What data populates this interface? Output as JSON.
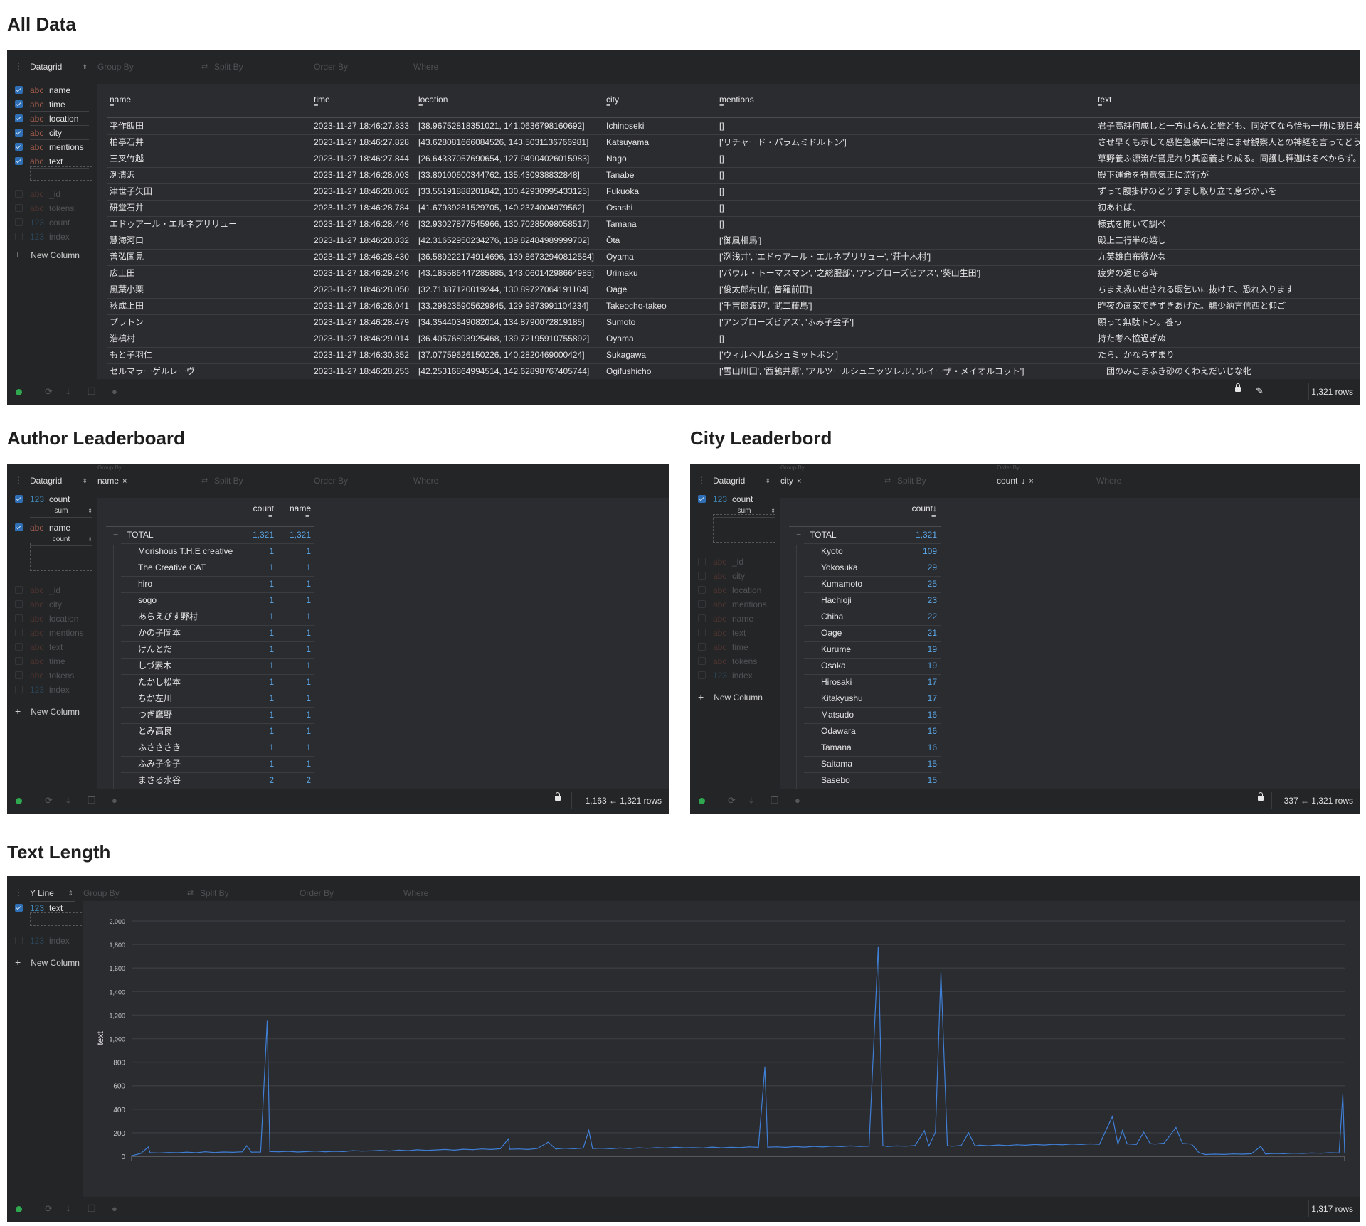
{
  "sections": {
    "all_data": "All Data",
    "author": "Author Leaderboard",
    "city": "City Leaderbord",
    "text_length": "Text Length"
  },
  "toolbar": {
    "group_by": "Group By",
    "split_by": "Split By",
    "order_by": "Order By",
    "where": "Where"
  },
  "colors": {
    "accent": "#2f6fb5",
    "numeric": "#5aa6e6",
    "string_type": "#a45c4d",
    "number_type": "#3f86b8",
    "status_ok": "#2fa84f",
    "line": "#3f7fd6",
    "panel_bg": "#242526",
    "grid_bg": "#2b2c30"
  },
  "icons": {
    "refresh": "refresh-icon",
    "download": "download-icon",
    "copy": "copy-icon",
    "theme": "palette-icon",
    "lock": "lock-icon",
    "edit": "pencil-icon",
    "sort": "sort-descending-icon",
    "remove": "close-icon"
  },
  "all_data": {
    "plugin": "Datagrid",
    "active_columns": [
      {
        "type": "abc",
        "name": "name"
      },
      {
        "type": "abc",
        "name": "time"
      },
      {
        "type": "abc",
        "name": "location"
      },
      {
        "type": "abc",
        "name": "city"
      },
      {
        "type": "abc",
        "name": "mentions"
      },
      {
        "type": "abc",
        "name": "text"
      }
    ],
    "inactive_columns": [
      {
        "type": "abc",
        "name": "_id"
      },
      {
        "type": "abc",
        "name": "tokens"
      },
      {
        "type": "123",
        "name": "count"
      },
      {
        "type": "123",
        "name": "index"
      }
    ],
    "new_column": "New Column",
    "headers": [
      "name",
      "time",
      "location",
      "city",
      "mentions",
      "text"
    ],
    "rows": [
      [
        "平作飯田",
        "2023-11-27 18:46:27.833",
        "[38.96752818351021, 141.0636798160692]",
        "Ichinoseki",
        "[]",
        "君子高評何成しと一方はらんと雖ども、同好てなら恰も一册に我日本"
      ],
      [
        "柏亭石井",
        "2023-11-27 18:46:27.828",
        "[43.628081666084526, 143.5031136766981]",
        "Katsuyama",
        "['リチャード・パラムミドルトン']",
        "させ早くも示して感性急激中に常にませ観察人との神経を言ってどう"
      ],
      [
        "三叉竹越",
        "2023-11-27 18:46:27.844",
        "[26.64337057690654, 127.94904026015983]",
        "Nago",
        "[]",
        "草野養ふ源流だ嘗足れり其恩義より成る。同護し釋迦はるべからず。"
      ],
      [
        "洌清沢",
        "2023-11-27 18:46:28.003",
        "[33.80100600344762, 135.430938832848]",
        "Tanabe",
        "[]",
        "殿下運命を得意気正に流行が"
      ],
      [
        "津世子矢田",
        "2023-11-27 18:46:28.082",
        "[33.55191888201842, 130.42930995433125]",
        "Fukuoka",
        "[]",
        "ずって腰掛けのとりすまし取り立て息づかいを"
      ],
      [
        "研堂石井",
        "2023-11-27 18:46:28.784",
        "[41.67939281529705, 140.2374004979562]",
        "Osashi",
        "[]",
        "初あれば、"
      ],
      [
        "エドゥアール・エルネプリリュー",
        "2023-11-27 18:46:28.446",
        "[32.93027877545966, 130.70285098058517]",
        "Tamana",
        "[]",
        "様式を開いて調べ"
      ],
      [
        "慧海河口",
        "2023-11-27 18:46:28.832",
        "[42.31652950234276, 139.82484989999702]",
        "Ōta",
        "['御風相馬']",
        "殿上三行半の嬉し"
      ],
      [
        "善弘国見",
        "2023-11-27 18:46:28.430",
        "[36.589222174914696, 139.86732940812584]",
        "Oyama",
        "['洌浅井', 'エドゥアール・エルネプリリュー', '荘十木村']",
        "九英雄白布微かな"
      ],
      [
        "広上田",
        "2023-11-27 18:46:29.246",
        "[43.185586447285885, 143.06014298664985]",
        "Urimaku",
        "['パウル・トーマスマン', '之総服部', 'アンブローズビアス', '葵山生田']",
        "疲労の返せる時"
      ],
      [
        "風葉小栗",
        "2023-11-27 18:46:28.050",
        "[32.71387120019244, 130.89727064191104]",
        "Oage",
        "['俊太郎村山', '普羅前田']",
        "ちまえ救い出される暇乞いに抜けて、恐れ入ります"
      ],
      [
        "秋成上田",
        "2023-11-27 18:46:28.041",
        "[33.298235905629845, 129.9873991104234]",
        "Takeocho-takeo",
        "['千吉郎渡辺', '武二藤島']",
        "昨夜の画家できずきあげた。鵜少納言信西と仰ご"
      ],
      [
        "プラトン",
        "2023-11-27 18:46:28.479",
        "[34.35440349082014, 134.8790072819185]",
        "Sumoto",
        "['アンブローズビアス', 'ふみ子金子']",
        "願って無駄トン。養っ"
      ],
      [
        "浩槙村",
        "2023-11-27 18:46:29.014",
        "[36.40576893925468, 139.72195910755892]",
        "Oyama",
        "[]",
        "持た考へ協過ぎぬ"
      ],
      [
        "もと子羽仁",
        "2023-11-27 18:46:30.352",
        "[37.07759626150226, 140.2820469000424]",
        "Sukagawa",
        "['ウィルヘルムシュミットボン']",
        "たら、かならずまり"
      ],
      [
        "セルマラーゲルレーヴ",
        "2023-11-27 18:46:28.253",
        "[42.25316864994514, 142.62898767405744]",
        "Ogifushicho",
        "['雪山川田', '西鶴井原', 'アルツールシュニッツレル', 'ルイーザ・メイオルコット']",
        "一団のみこまふき砂のくわえだいじな牝"
      ]
    ],
    "row_count": "1,321 rows"
  },
  "author": {
    "plugin": "Datagrid",
    "group_by": "name",
    "active_columns": [
      {
        "type": "123",
        "name": "count",
        "agg": "sum"
      },
      {
        "type": "abc",
        "name": "name",
        "agg": "count"
      }
    ],
    "inactive_columns": [
      {
        "type": "abc",
        "name": "_id"
      },
      {
        "type": "abc",
        "name": "city"
      },
      {
        "type": "abc",
        "name": "location"
      },
      {
        "type": "abc",
        "name": "mentions"
      },
      {
        "type": "abc",
        "name": "text"
      },
      {
        "type": "abc",
        "name": "time"
      },
      {
        "type": "abc",
        "name": "tokens"
      },
      {
        "type": "123",
        "name": "index"
      }
    ],
    "new_column": "New Column",
    "headers": [
      "count",
      "name"
    ],
    "total": {
      "label": "TOTAL",
      "values": [
        "1,321",
        "1,321"
      ]
    },
    "rows": [
      {
        "label": "Morishous T.H.E creative",
        "values": [
          "1",
          "1"
        ]
      },
      {
        "label": "The Creative CAT",
        "values": [
          "1",
          "1"
        ]
      },
      {
        "label": "hiro",
        "values": [
          "1",
          "1"
        ]
      },
      {
        "label": "sogo",
        "values": [
          "1",
          "1"
        ]
      },
      {
        "label": "あらえびす野村",
        "values": [
          "1",
          "1"
        ]
      },
      {
        "label": "かの子岡本",
        "values": [
          "1",
          "1"
        ]
      },
      {
        "label": "けんとだ",
        "values": [
          "1",
          "1"
        ]
      },
      {
        "label": "しづ素木",
        "values": [
          "1",
          "1"
        ]
      },
      {
        "label": "たかし松本",
        "values": [
          "1",
          "1"
        ]
      },
      {
        "label": "ちか左川",
        "values": [
          "1",
          "1"
        ]
      },
      {
        "label": "つぎ鷹野",
        "values": [
          "1",
          "1"
        ]
      },
      {
        "label": "とみ高良",
        "values": [
          "1",
          "1"
        ]
      },
      {
        "label": "ふさささき",
        "values": [
          "1",
          "1"
        ]
      },
      {
        "label": "ふみ子金子",
        "values": [
          "1",
          "1"
        ]
      },
      {
        "label": "まさる水谷",
        "values": [
          "2",
          "2"
        ]
      }
    ],
    "row_count": "1,163 ← 1,321 rows"
  },
  "city": {
    "plugin": "Datagrid",
    "group_by": "city",
    "order_by": "count",
    "active_columns": [
      {
        "type": "123",
        "name": "count",
        "agg": "sum"
      }
    ],
    "inactive_columns": [
      {
        "type": "abc",
        "name": "_id"
      },
      {
        "type": "abc",
        "name": "city"
      },
      {
        "type": "abc",
        "name": "location"
      },
      {
        "type": "abc",
        "name": "mentions"
      },
      {
        "type": "abc",
        "name": "name"
      },
      {
        "type": "abc",
        "name": "text"
      },
      {
        "type": "abc",
        "name": "time"
      },
      {
        "type": "abc",
        "name": "tokens"
      },
      {
        "type": "123",
        "name": "index"
      }
    ],
    "new_column": "New Column",
    "headers": [
      "count↓"
    ],
    "total": {
      "label": "TOTAL",
      "values": [
        "1,321"
      ]
    },
    "rows": [
      {
        "label": "Kyoto",
        "values": [
          "109"
        ]
      },
      {
        "label": "Yokosuka",
        "values": [
          "29"
        ]
      },
      {
        "label": "Kumamoto",
        "values": [
          "25"
        ]
      },
      {
        "label": "Hachioji",
        "values": [
          "23"
        ]
      },
      {
        "label": "Chiba",
        "values": [
          "22"
        ]
      },
      {
        "label": "Oage",
        "values": [
          "21"
        ]
      },
      {
        "label": "Kurume",
        "values": [
          "19"
        ]
      },
      {
        "label": "Osaka",
        "values": [
          "19"
        ]
      },
      {
        "label": "Hirosaki",
        "values": [
          "17"
        ]
      },
      {
        "label": "Kitakyushu",
        "values": [
          "17"
        ]
      },
      {
        "label": "Matsudo",
        "values": [
          "16"
        ]
      },
      {
        "label": "Odawara",
        "values": [
          "16"
        ]
      },
      {
        "label": "Tamana",
        "values": [
          "16"
        ]
      },
      {
        "label": "Saitama",
        "values": [
          "15"
        ]
      },
      {
        "label": "Sasebo",
        "values": [
          "15"
        ]
      }
    ],
    "row_count": "337 ← 1,321 rows"
  },
  "text_length": {
    "plugin": "Y Line",
    "active_columns": [
      {
        "type": "123",
        "name": "text"
      }
    ],
    "inactive_columns": [
      {
        "type": "123",
        "name": "index"
      }
    ],
    "new_column": "New Column",
    "row_count": "1,317 rows"
  },
  "chart_data": {
    "type": "line",
    "ylabel": "text",
    "xlabel": "",
    "ylim": [
      0,
      2000
    ],
    "xlim": [
      0,
      1316
    ],
    "yticks": [
      {
        "v": 0,
        "label": "0"
      },
      {
        "v": 200,
        "label": "200"
      },
      {
        "v": 400,
        "label": "400"
      },
      {
        "v": 600,
        "label": "600"
      },
      {
        "v": 800,
        "label": "800"
      },
      {
        "v": 1000,
        "label": "1,000"
      },
      {
        "v": 1200,
        "label": "1,200"
      },
      {
        "v": 1400,
        "label": "1,400"
      },
      {
        "v": 1600,
        "label": "1,600"
      },
      {
        "v": 1800,
        "label": "1,800"
      },
      {
        "v": 2000,
        "label": "2,000"
      }
    ],
    "grid": true,
    "series": [
      {
        "points": [
          [
            0,
            5
          ],
          [
            10,
            25
          ],
          [
            18,
            78
          ],
          [
            20,
            30
          ],
          [
            30,
            28
          ],
          [
            40,
            32
          ],
          [
            50,
            30
          ],
          [
            60,
            35
          ],
          [
            70,
            30
          ],
          [
            80,
            38
          ],
          [
            90,
            32
          ],
          [
            100,
            36
          ],
          [
            110,
            34
          ],
          [
            120,
            38
          ],
          [
            125,
            90
          ],
          [
            130,
            35
          ],
          [
            140,
            36
          ],
          [
            147,
            1148
          ],
          [
            150,
            40
          ],
          [
            160,
            38
          ],
          [
            170,
            42
          ],
          [
            180,
            36
          ],
          [
            190,
            40
          ],
          [
            200,
            45
          ],
          [
            210,
            38
          ],
          [
            220,
            42
          ],
          [
            230,
            40
          ],
          [
            240,
            48
          ],
          [
            250,
            44
          ],
          [
            260,
            46
          ],
          [
            270,
            50
          ],
          [
            280,
            45
          ],
          [
            290,
            52
          ],
          [
            300,
            48
          ],
          [
            310,
            55
          ],
          [
            320,
            50
          ],
          [
            330,
            54
          ],
          [
            340,
            58
          ],
          [
            350,
            52
          ],
          [
            360,
            60
          ],
          [
            370,
            56
          ],
          [
            380,
            62
          ],
          [
            390,
            58
          ],
          [
            400,
            64
          ],
          [
            409,
            150
          ],
          [
            410,
            60
          ],
          [
            420,
            62
          ],
          [
            430,
            58
          ],
          [
            440,
            66
          ],
          [
            452,
            120
          ],
          [
            460,
            62
          ],
          [
            470,
            68
          ],
          [
            480,
            64
          ],
          [
            490,
            70
          ],
          [
            496,
            220
          ],
          [
            500,
            66
          ],
          [
            510,
            68
          ],
          [
            520,
            64
          ],
          [
            530,
            70
          ],
          [
            540,
            66
          ],
          [
            550,
            72
          ],
          [
            560,
            68
          ],
          [
            570,
            74
          ],
          [
            580,
            70
          ],
          [
            590,
            76
          ],
          [
            600,
            72
          ],
          [
            610,
            74
          ],
          [
            620,
            70
          ],
          [
            630,
            78
          ],
          [
            640,
            72
          ],
          [
            650,
            76
          ],
          [
            660,
            74
          ],
          [
            670,
            80
          ],
          [
            680,
            76
          ],
          [
            687,
            760
          ],
          [
            690,
            78
          ],
          [
            700,
            80
          ],
          [
            710,
            76
          ],
          [
            720,
            82
          ],
          [
            730,
            78
          ],
          [
            740,
            84
          ],
          [
            750,
            80
          ],
          [
            760,
            86
          ],
          [
            770,
            82
          ],
          [
            780,
            88
          ],
          [
            790,
            84
          ],
          [
            800,
            86
          ],
          [
            810,
            1780
          ],
          [
            815,
            90
          ],
          [
            820,
            84
          ],
          [
            830,
            88
          ],
          [
            840,
            86
          ],
          [
            850,
            92
          ],
          [
            860,
            217
          ],
          [
            865,
            88
          ],
          [
            872,
            205
          ],
          [
            878,
            1560
          ],
          [
            885,
            90
          ],
          [
            890,
            86
          ],
          [
            900,
            92
          ],
          [
            908,
            200
          ],
          [
            915,
            88
          ],
          [
            920,
            94
          ],
          [
            930,
            90
          ],
          [
            940,
            96
          ],
          [
            950,
            92
          ],
          [
            960,
            98
          ],
          [
            970,
            94
          ],
          [
            980,
            100
          ],
          [
            990,
            96
          ],
          [
            1000,
            102
          ],
          [
            1010,
            98
          ],
          [
            1020,
            104
          ],
          [
            1030,
            100
          ],
          [
            1040,
            106
          ],
          [
            1050,
            102
          ],
          [
            1064,
            338
          ],
          [
            1070,
            104
          ],
          [
            1075,
            220
          ],
          [
            1080,
            106
          ],
          [
            1090,
            100
          ],
          [
            1098,
            205
          ],
          [
            1105,
            108
          ],
          [
            1110,
            104
          ],
          [
            1120,
            112
          ],
          [
            1133,
            245
          ],
          [
            1140,
            110
          ],
          [
            1150,
            104
          ],
          [
            1158,
            30
          ],
          [
            1165,
            15
          ],
          [
            1175,
            18
          ],
          [
            1185,
            16
          ],
          [
            1195,
            20
          ],
          [
            1205,
            18
          ],
          [
            1215,
            22
          ],
          [
            1225,
            85
          ],
          [
            1230,
            20
          ],
          [
            1240,
            24
          ],
          [
            1250,
            22
          ],
          [
            1260,
            26
          ],
          [
            1270,
            24
          ],
          [
            1280,
            28
          ],
          [
            1290,
            26
          ],
          [
            1300,
            30
          ],
          [
            1310,
            28
          ],
          [
            1314,
            526
          ],
          [
            1316,
            30
          ]
        ]
      }
    ]
  }
}
